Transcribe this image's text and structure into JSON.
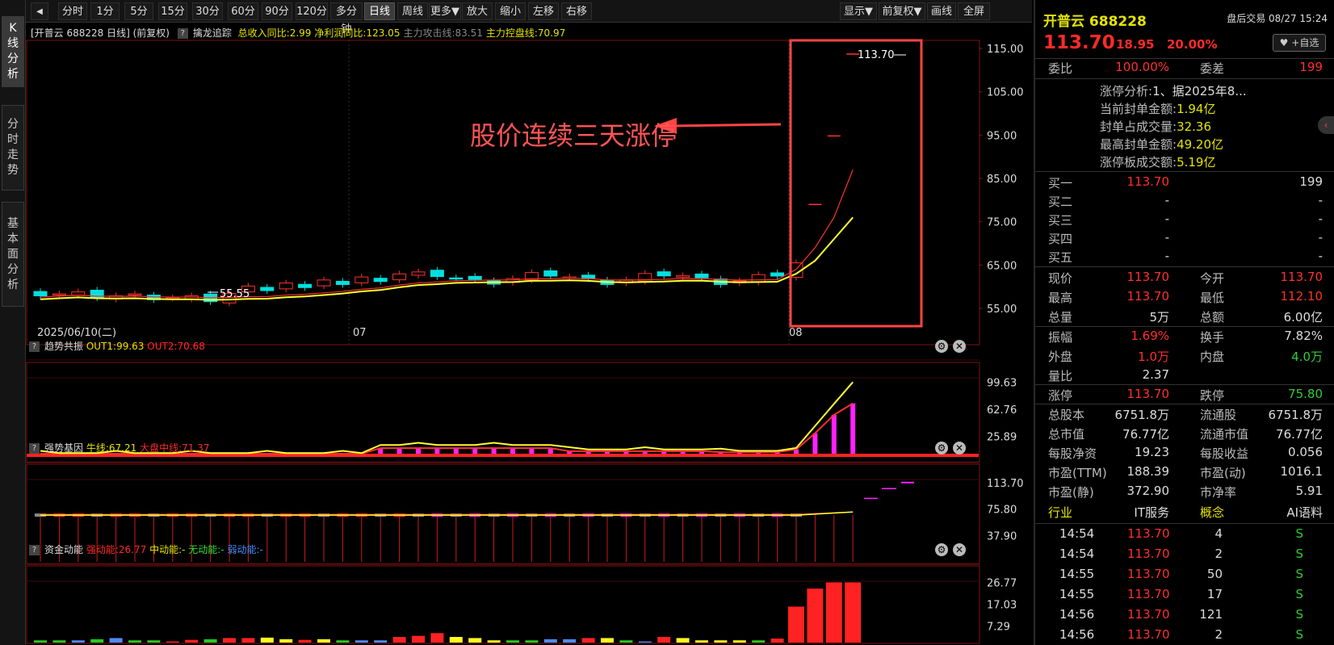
{
  "rail": {
    "tabs": [
      {
        "label": "K线分析"
      },
      {
        "label": "分时走势"
      },
      {
        "label": "基本面分析"
      }
    ]
  },
  "toolbar": {
    "left": [
      "分时",
      "1分",
      "5分",
      "15分",
      "30分",
      "60分",
      "90分",
      "120分",
      "多分钟",
      "日线",
      "周线",
      "更多▼",
      "放大",
      "缩小",
      "左移",
      "右移"
    ],
    "right": [
      "显示▼",
      "前复权▼",
      "画线",
      "全屏"
    ],
    "active": "日线"
  },
  "main": {
    "title": "[开普云 688228 日线] (前复权)",
    "indicator_name": "擒龙追踪",
    "indicator_values": [
      {
        "text": "总收入同比:2.99",
        "color": "#e4e400"
      },
      {
        "text": "净利润同比:123.05",
        "color": "#e4e400"
      },
      {
        "text": "主力攻击线:83.51",
        "color": "#888"
      },
      {
        "text": "主力控盘线:70.97",
        "color": "#e4e400"
      }
    ],
    "y_ticks": [
      "115.00",
      "105.00",
      "95.00",
      "85.00",
      "75.00",
      "65.00",
      "55.00"
    ],
    "x_ticks": [
      "2025/06/10(二)",
      "07",
      "08"
    ],
    "high_label": "113.70",
    "low_label": "55.55",
    "annotation": "股价连续三天涨停"
  },
  "panel1": {
    "name": "趋势共振",
    "v1": "OUT1:99.63",
    "v2": "OUT2:70.68",
    "y_ticks": [
      "99.63",
      "62.76",
      "25.89"
    ]
  },
  "panel2": {
    "name": "强势基因",
    "v1": "牛线:67.21",
    "v2": "大盘中线:71.37",
    "y_ticks": [
      "113.70",
      "75.80",
      "37.90"
    ]
  },
  "panel3": {
    "name": "资金动能",
    "v1": "强动能:26.77",
    "v2": "中动能:-",
    "v3": "无动能:-",
    "v4": "弱动能:-",
    "y_ticks": [
      "26.77",
      "17.03",
      "7.29"
    ]
  },
  "quote": {
    "name": "开普云 688228",
    "status": "盘后交易 08/27 15:24",
    "price": "113.70",
    "change": "18.95",
    "pct": "20.00%",
    "watch_label": "+自选",
    "weibi_label": "委比",
    "weibi": "100.00%",
    "weicha_label": "委差",
    "weicha": "199",
    "analysis": [
      {
        "k": "涨停分析:",
        "v": "1、据2025年8..."
      },
      {
        "k": "当前封单金额:",
        "v": "1.94亿"
      },
      {
        "k": "封单占成交量:",
        "v": "32.36"
      },
      {
        "k": "最高封单金额:",
        "v": "49.20亿"
      },
      {
        "k": "涨停板成交额:",
        "v": "5.19亿"
      }
    ],
    "book": [
      {
        "k": "买一",
        "p": "113.70",
        "v": "199"
      },
      {
        "k": "买二",
        "p": "-",
        "v": "-"
      },
      {
        "k": "买三",
        "p": "-",
        "v": "-"
      },
      {
        "k": "买四",
        "p": "-",
        "v": "-"
      },
      {
        "k": "买五",
        "p": "-",
        "v": "-"
      }
    ],
    "stats1": [
      {
        "k1": "现价",
        "v1": "113.70",
        "c1": "#ff3030",
        "k2": "今开",
        "v2": "113.70",
        "c2": "#ff3030"
      },
      {
        "k1": "最高",
        "v1": "113.70",
        "c1": "#ff3030",
        "k2": "最低",
        "v2": "112.10",
        "c2": "#ff3030"
      },
      {
        "k1": "总量",
        "v1": "5万",
        "c1": "#ddd",
        "k2": "总额",
        "v2": "6.00亿",
        "c2": "#ddd"
      }
    ],
    "stats2": [
      {
        "k1": "振幅",
        "v1": "1.69%",
        "c1": "#ff3030",
        "k2": "换手",
        "v2": "7.82%",
        "c2": "#ddd"
      },
      {
        "k1": "外盘",
        "v1": "1.0万",
        "c1": "#ff3030",
        "k2": "内盘",
        "v2": "4.0万",
        "c2": "#33cc33"
      },
      {
        "k1": "量比",
        "v1": "2.37",
        "c1": "#ddd",
        "k2": "",
        "v2": "",
        "c2": "#ddd"
      }
    ],
    "stats3": [
      {
        "k1": "涨停",
        "v1": "113.70",
        "c1": "#ff3030",
        "k2": "跌停",
        "v2": "75.80",
        "c2": "#33cc33"
      }
    ],
    "stats4": [
      {
        "k1": "总股本",
        "v1": "6751.8万",
        "c1": "#ddd",
        "k2": "流通股",
        "v2": "6751.8万",
        "c2": "#ddd"
      },
      {
        "k1": "总市值",
        "v1": "76.77亿",
        "c1": "#ddd",
        "k2": "流通市值",
        "v2": "76.77亿",
        "c2": "#ddd"
      },
      {
        "k1": "每股净资",
        "v1": "19.23",
        "c1": "#ddd",
        "k2": "每股收益",
        "v2": "0.056",
        "c2": "#ddd"
      },
      {
        "k1": "市盈(TTM)",
        "v1": "188.39",
        "c1": "#ddd",
        "k2": "市盈(动)",
        "v2": "1016.1",
        "c2": "#ddd"
      },
      {
        "k1": "市盈(静)",
        "v1": "372.90",
        "c1": "#ddd",
        "k2": "市净率",
        "v2": "5.91",
        "c2": "#ddd"
      }
    ],
    "industry": {
      "k1": "行业",
      "v1": "IT服务",
      "k2": "概念",
      "v2": "AI语料"
    },
    "ticks": [
      {
        "t": "14:54",
        "p": "113.70",
        "v": "4",
        "s": "S"
      },
      {
        "t": "14:54",
        "p": "113.70",
        "v": "2",
        "s": "S"
      },
      {
        "t": "14:55",
        "p": "113.70",
        "v": "50",
        "s": "S"
      },
      {
        "t": "14:55",
        "p": "113.70",
        "v": "17",
        "s": "S"
      },
      {
        "t": "14:56",
        "p": "113.70",
        "v": "121",
        "s": "S"
      },
      {
        "t": "14:56",
        "p": "113.70",
        "v": "2",
        "s": "S"
      }
    ]
  }
}
